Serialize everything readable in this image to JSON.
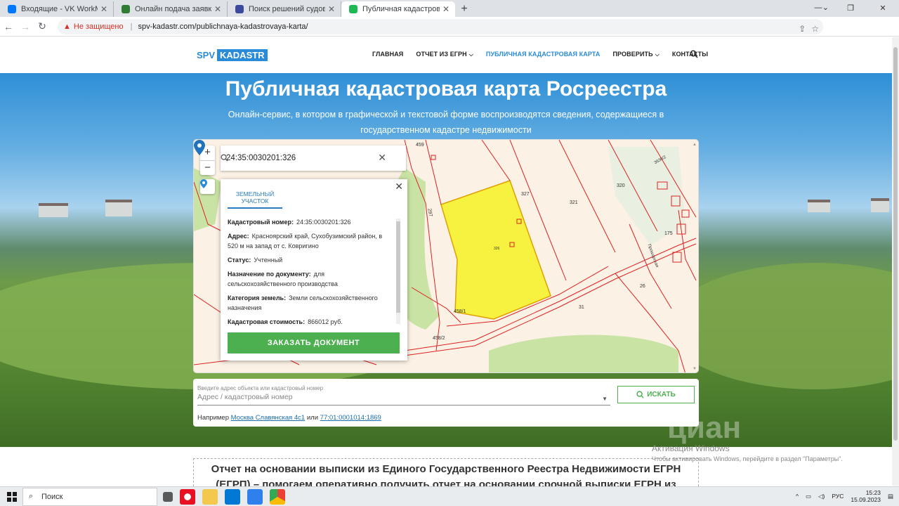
{
  "browser": {
    "tabs": [
      {
        "title": "Входящие - VK WorkMail",
        "color": "#0077ff"
      },
      {
        "title": "Онлайн подача заявки на ипоте",
        "color": "#2e7d32"
      },
      {
        "title": "Поиск решений судов общей ю",
        "color": "#3b4a9c"
      },
      {
        "title": "Публичная кадастровая карта",
        "color": "#1db954"
      }
    ],
    "security_label": "Не защищено",
    "url": "spv-kadastr.com/publichnaya-kadastrovaya-karta/"
  },
  "header": {
    "logo_a": "SPV",
    "logo_b": "KADASTR",
    "nav": [
      "ГЛАВНАЯ",
      "ОТЧЕТ ИЗ ЕГРН",
      "ПУБЛИЧНАЯ КАДАСТРОВАЯ КАРТА",
      "ПРОВЕРИТЬ",
      "КОНТАКТЫ"
    ]
  },
  "hero": {
    "title": "Публичная кадастровая карта Росреестра",
    "subtitle": "Онлайн-сервис, в котором в графической и текстовой форме воспроизводятся сведения, содержащиеся в государственном кадастре недвижимости"
  },
  "map": {
    "zoom_in": "+",
    "zoom_out": "−",
    "search_value": "24:35:0030201:326",
    "labels": [
      "459",
      "327",
      "321",
      "320",
      "297",
      "458/1",
      "458/2",
      "31",
      "26",
      "175",
      "326",
      "3630/2",
      "Прошарская"
    ],
    "popup": {
      "tab": "ЗЕМЕЛЬНЫЙ УЧАСТОК",
      "rows": [
        {
          "label": "Кадастровый номер:",
          "value": "24:35:0030201:326"
        },
        {
          "label": "Адрес:",
          "value": "Красноярский край, Сухобузимский район, в 520 м на запад от с. Ковригино"
        },
        {
          "label": "Статус:",
          "value": "Учтенный"
        },
        {
          "label": "Назначение по документу:",
          "value": "для сельскохозяйственного производства"
        },
        {
          "label": "Категория земель:",
          "value": "Земли сельскохозяйственного назначения"
        },
        {
          "label": "Кадастровая стоимость:",
          "value": "866012 руб."
        }
      ],
      "order_button": "ЗАКАЗАТЬ ДОКУМЕНТ"
    }
  },
  "search": {
    "field_label": "Введите адрес объекта или кадастровый номер",
    "placeholder": "Адрес / кадастровый номер",
    "button": "ИСКАТЬ",
    "example_prefix": "Например",
    "example_link1": "Москва Славянская 4с1",
    "example_or": "или",
    "example_link2": "77:01:0001014:1869"
  },
  "below": {
    "text": "Отчет на основании выписки из Единого Государственного Реестра Недвижимости ЕГРН (ЕГРП) – помогаем оперативно получить отчет на основании срочной выписки ЕГРН из Росреестра с печатью."
  },
  "watermark": {
    "line1": "Активация Windows",
    "line2": "Чтобы активировать Windows, перейдите в раздел \"Параметры\".",
    "brand": "циан"
  },
  "taskbar": {
    "search": "Поиск",
    "lang": "РУС",
    "time": "15:23",
    "date": "15.09.2023"
  }
}
